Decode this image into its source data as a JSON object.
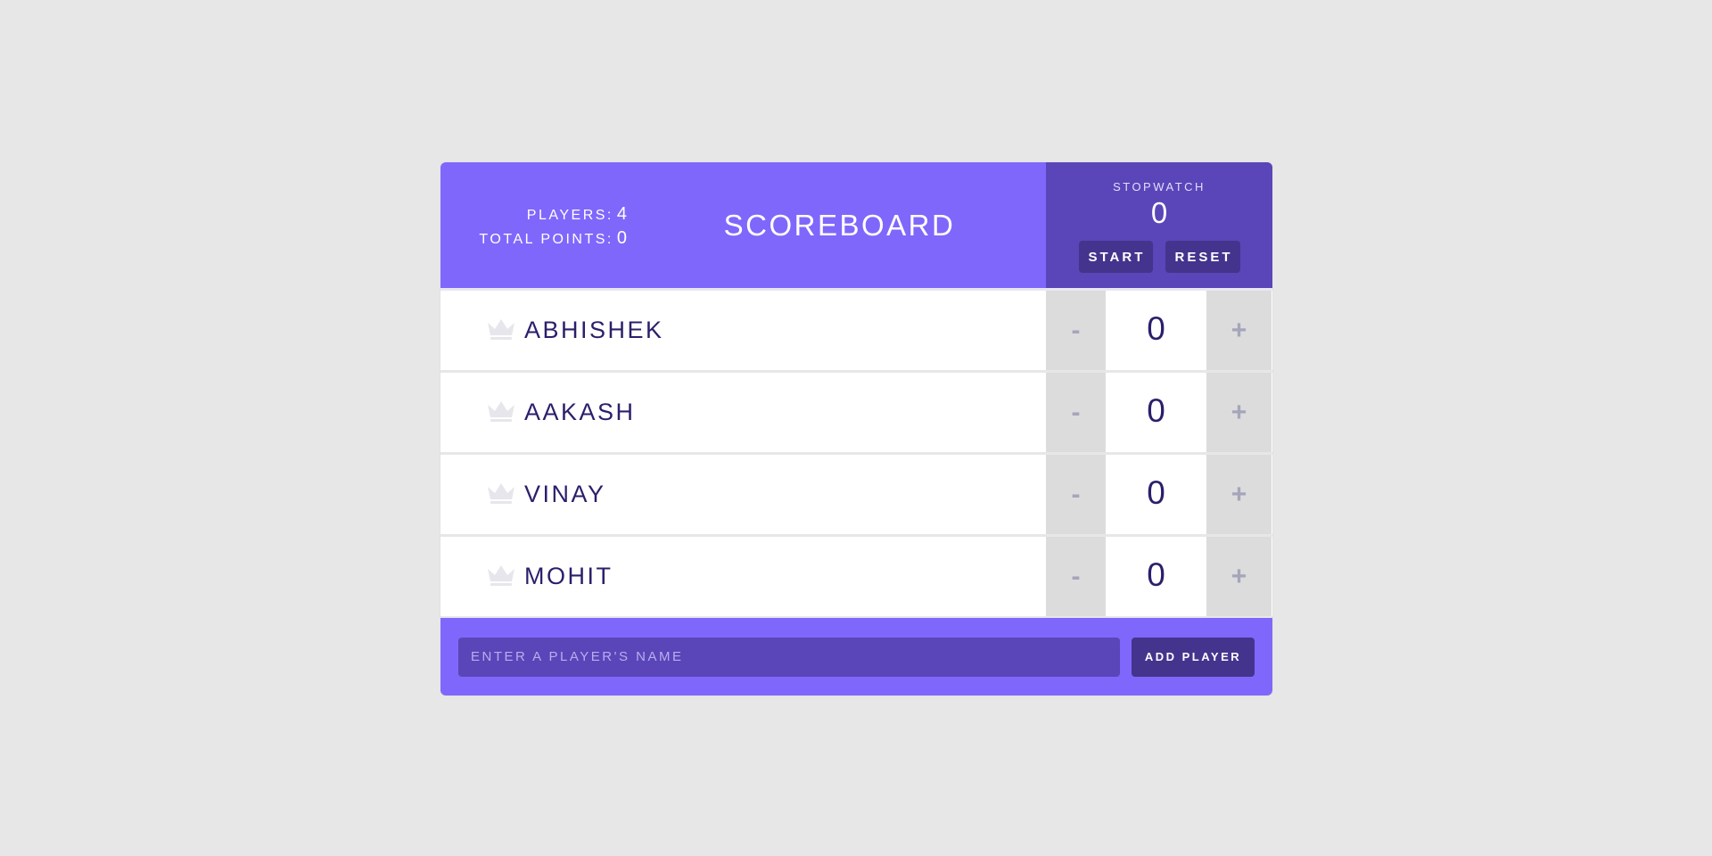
{
  "header": {
    "players_label": "PLAYERS:",
    "players_value": "4",
    "total_points_label": "TOTAL POINTS:",
    "total_points_value": "0",
    "title": "SCOREBOARD"
  },
  "stopwatch": {
    "label": "STOPWATCH",
    "time": "0",
    "start_label": "START",
    "reset_label": "RESET"
  },
  "players": [
    {
      "name": "ABHISHEK",
      "score": "0",
      "dec_label": "-",
      "inc_label": "+",
      "icon": "crown-icon"
    },
    {
      "name": "AAKASH",
      "score": "0",
      "dec_label": "-",
      "inc_label": "+",
      "icon": "crown-icon"
    },
    {
      "name": "VINAY",
      "score": "0",
      "dec_label": "-",
      "inc_label": "+",
      "icon": "crown-icon"
    },
    {
      "name": "MOHIT",
      "score": "0",
      "dec_label": "-",
      "inc_label": "+",
      "icon": "crown-icon"
    }
  ],
  "form": {
    "placeholder": "ENTER A PLAYER'S NAME",
    "value": "",
    "add_label": "ADD PLAYER"
  },
  "colors": {
    "page_background": "#e7e7e7",
    "primary": "#8067fb",
    "primary_dark": "#5a46b8",
    "button": "#44348d",
    "text_dark": "#2b1f6b",
    "counter_background": "#dcdcdc",
    "crown_inactive": "#e6e6ec"
  }
}
